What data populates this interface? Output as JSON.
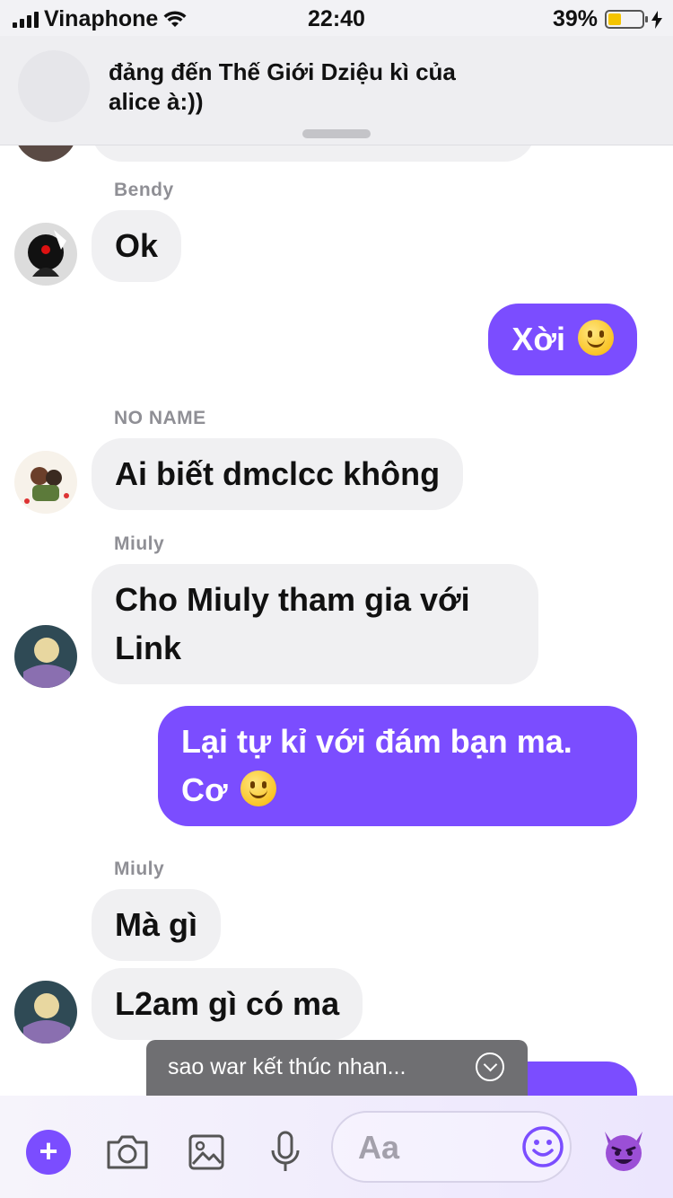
{
  "status_bar": {
    "carrier": "Vinaphone",
    "time": "22:40",
    "battery": "39%",
    "battery_level": 0.39
  },
  "notification": {
    "text": "đảng đến Thế Giới Dziệu kì của alice à:))"
  },
  "messages": [
    {
      "sender": "Bendy",
      "text": "Ok"
    },
    {
      "text": "Xời"
    },
    {
      "sender": "NO NAME",
      "text": "Ai biết dmclcc không"
    },
    {
      "sender": "Miuly",
      "line1": "Cho Miuly tham gia với",
      "line2": "Link"
    },
    {
      "line1": "Lại tự kỉ với đám bạn ma.",
      "line2": "Cơ"
    },
    {
      "sender": "Miuly",
      "text": "Mà gì"
    },
    {
      "text": "L2am gì có ma"
    }
  ],
  "toast": {
    "text": "sao war kết thúc nhan..."
  },
  "composer": {
    "placeholder": "Aa",
    "icons": [
      "plus-icon",
      "camera-icon",
      "image-icon",
      "microphone-icon",
      "smiley-icon",
      "devil-emoji-icon"
    ]
  },
  "colors": {
    "accent": "#7b4dff",
    "incoming_bubble": "#f0f0f2",
    "toast": "#6f6f72"
  }
}
